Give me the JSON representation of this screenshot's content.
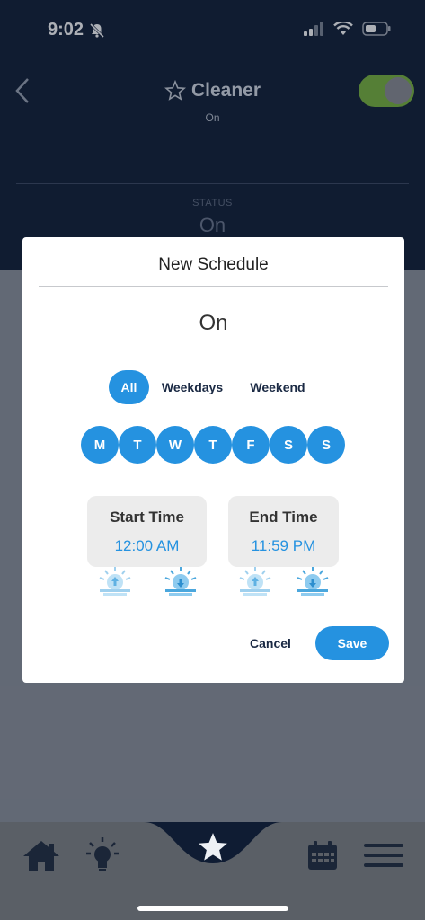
{
  "status_bar": {
    "time": "9:02"
  },
  "header": {
    "title": "Cleaner",
    "subtitle": "On",
    "status_label": "STATUS",
    "status_value": "On"
  },
  "modal": {
    "title": "New Schedule",
    "mode": "On",
    "segments": [
      {
        "label": "All",
        "active": true
      },
      {
        "label": "Weekdays",
        "active": false
      },
      {
        "label": "Weekend",
        "active": false
      }
    ],
    "days": [
      "M",
      "T",
      "W",
      "T",
      "F",
      "S",
      "S"
    ],
    "start": {
      "label": "Start Time",
      "value": "12:00 AM"
    },
    "end": {
      "label": "End Time",
      "value": "11:59 PM"
    },
    "sun_icons": [
      "sunrise-icon",
      "sunset-icon",
      "sunrise-icon",
      "sunset-icon"
    ],
    "cancel_label": "Cancel",
    "save_label": "Save"
  },
  "tabbar": {
    "items": [
      "home-icon",
      "lightbulb-icon",
      "star-icon",
      "calendar-icon",
      "menu-icon"
    ]
  },
  "colors": {
    "accent": "#2592e0",
    "toggle": "#79b43b",
    "header_bg": "#0f1c33"
  }
}
